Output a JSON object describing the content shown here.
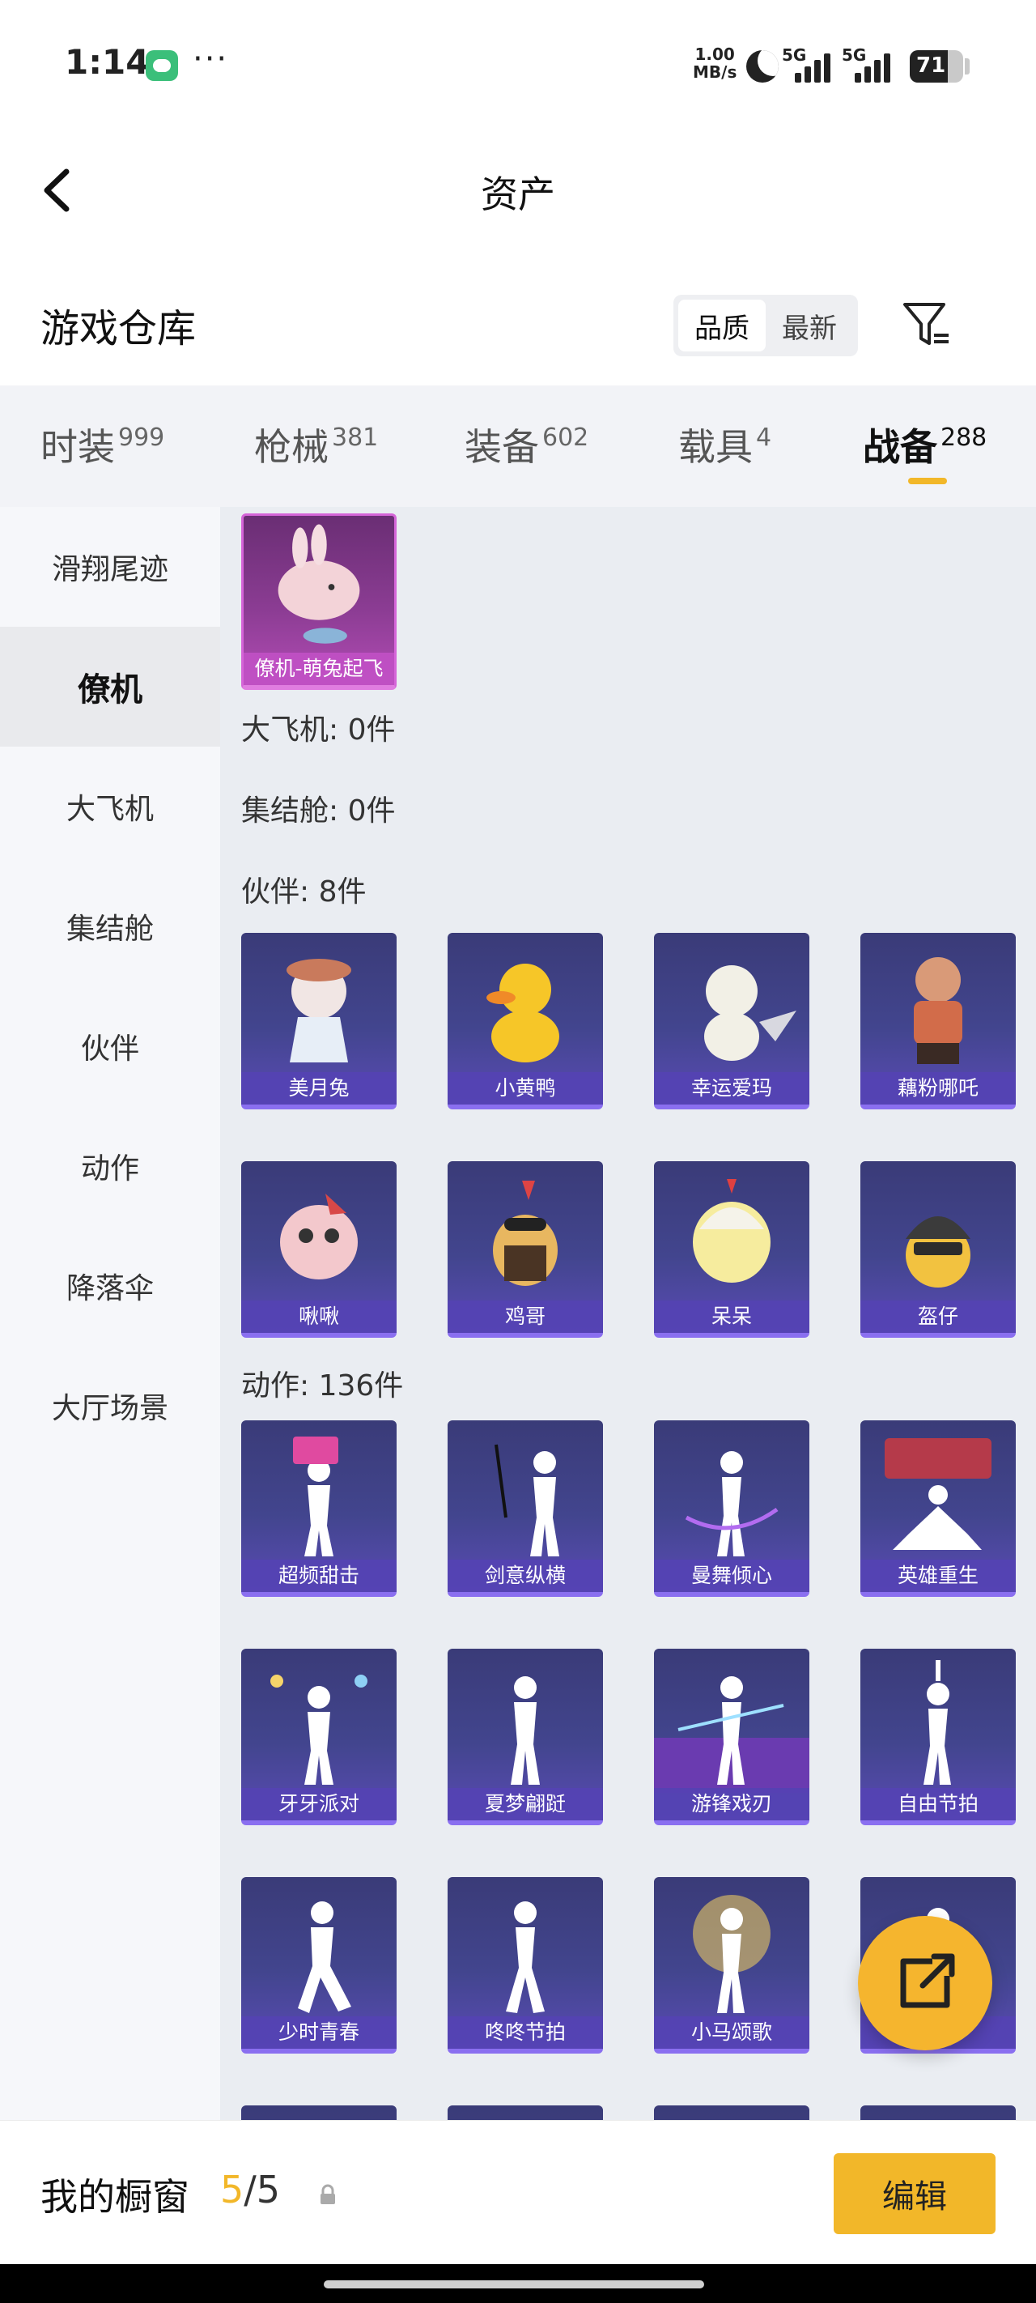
{
  "status_bar": {
    "time": "1:14",
    "net_speed_value": "1.00",
    "net_speed_unit": "MB/s",
    "signal1_label": "5G",
    "signal2_label": "5G",
    "battery_level": "71",
    "battery_fraction": 0.71
  },
  "nav": {
    "title": "资产"
  },
  "warehouse": {
    "title": "游戏仓库",
    "sort_options": [
      "品质",
      "最新"
    ],
    "active_sort": 0
  },
  "categories": [
    {
      "name": "时装",
      "count": "999"
    },
    {
      "name": "枪械",
      "count": "381"
    },
    {
      "name": "装备",
      "count": "602"
    },
    {
      "name": "载具",
      "count": "4"
    },
    {
      "name": "战备",
      "count": "288"
    }
  ],
  "active_category": 4,
  "sidebar": {
    "items": [
      "滑翔尾迹",
      "僚机",
      "大飞机",
      "集结舱",
      "伙伴",
      "动作",
      "降落伞",
      "大厅场景"
    ],
    "active": 1
  },
  "sections": {
    "wingman_item": "僚机-萌兔起飞",
    "big_plane": "大飞机: 0件",
    "capsule": "集结舱: 0件",
    "partner": "伙伴: 8件",
    "action": "动作: 136件"
  },
  "partners": [
    "美月兔",
    "小黄鸭",
    "幸运爱玛",
    "藕粉哪吒",
    "啾啾",
    "鸡哥",
    "呆呆",
    "盔仔"
  ],
  "actions": [
    "超频甜击",
    "剑意纵横",
    "曼舞倾心",
    "英雄重生",
    "牙牙派对",
    "夏梦翩跹",
    "游锋戏刃",
    "自由节拍",
    "少时青春",
    "咚咚节拍",
    "小马颂歌",
    ""
  ],
  "bottom": {
    "title": "我的橱窗",
    "current": "5",
    "separator": "/",
    "total": "5",
    "edit_label": "编辑"
  }
}
